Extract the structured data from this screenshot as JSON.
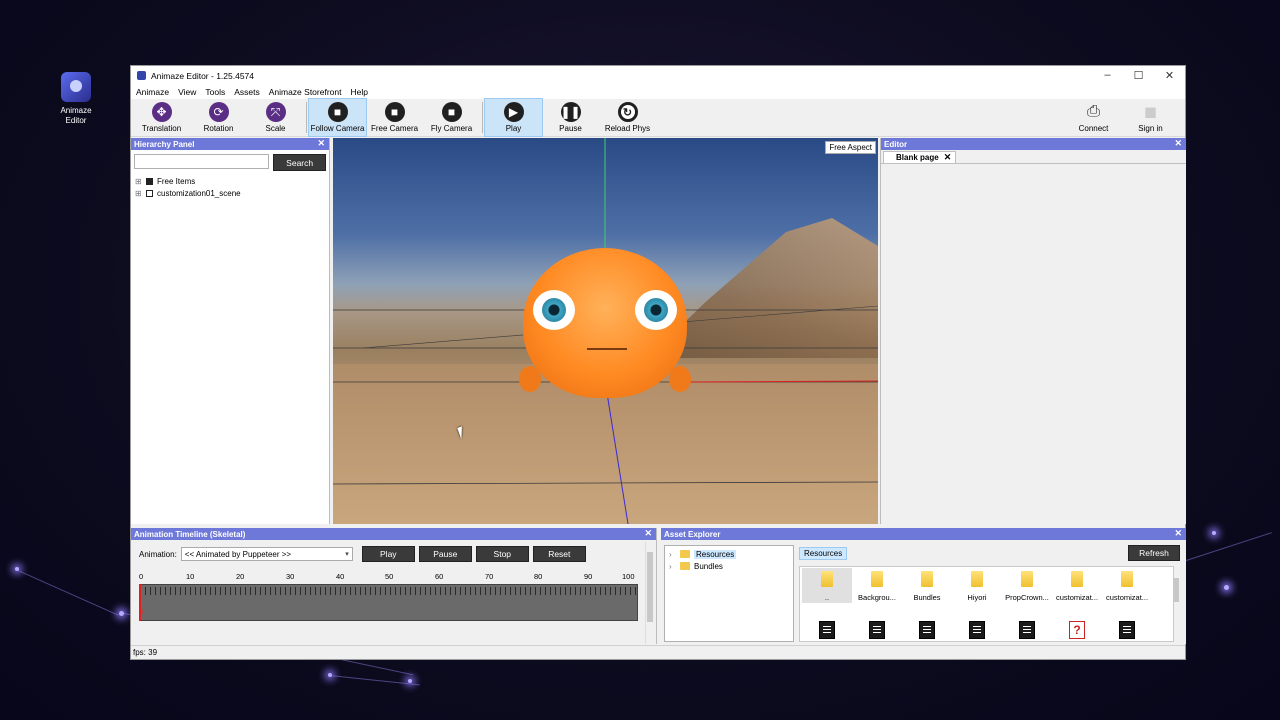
{
  "desktop": {
    "icon_label": "Animaze Editor"
  },
  "window": {
    "title": "Animaze Editor - 1.25.4574",
    "min": "–",
    "max": "☐",
    "close": "✕"
  },
  "menu": [
    "Animaze",
    "View",
    "Tools",
    "Assets",
    "Animaze Storefront",
    "Help"
  ],
  "toolbar": {
    "translation": "Translation",
    "rotation": "Rotation",
    "scale": "Scale",
    "follow_camera": "Follow Camera",
    "free_camera": "Free Camera",
    "fly_camera": "Fly Camera",
    "play": "Play",
    "pause": "Pause",
    "reload_phys": "Reload Phys",
    "connect": "Connect",
    "sign_in": "Sign in"
  },
  "hierarchy": {
    "title": "Hierarchy Panel",
    "search_placeholder": "",
    "search_button": "Search",
    "items": [
      {
        "label": "Free Items"
      },
      {
        "label": "customization01_scene"
      }
    ]
  },
  "viewport": {
    "aspect": "Free Aspect"
  },
  "editor": {
    "title": "Editor",
    "tab": "Blank page"
  },
  "timeline": {
    "title": "Animation Timeline (Skeletal)",
    "animation_label": "Animation:",
    "animation_value": "<< Animated by Puppeteer >>",
    "play": "Play",
    "pause": "Pause",
    "stop": "Stop",
    "reset": "Reset",
    "ticks": [
      "0",
      "10",
      "20",
      "30",
      "40",
      "50",
      "60",
      "70",
      "80",
      "90",
      "100"
    ],
    "playhead_text": "0"
  },
  "assets": {
    "title": "Asset Explorer",
    "tree": [
      "Resources",
      "Bundles"
    ],
    "breadcrumb": "Resources",
    "refresh": "Refresh",
    "folders": [
      "..",
      "Backgrou...",
      "Bundles",
      "Hiyori",
      "PropCrown...",
      "customizat...",
      "customizat..."
    ]
  },
  "status": {
    "fps": "fps: 39"
  },
  "colors": {
    "panel_header": "#6e78d8",
    "accent_purple": "#5a2e84",
    "selection": "#cce4f7"
  }
}
